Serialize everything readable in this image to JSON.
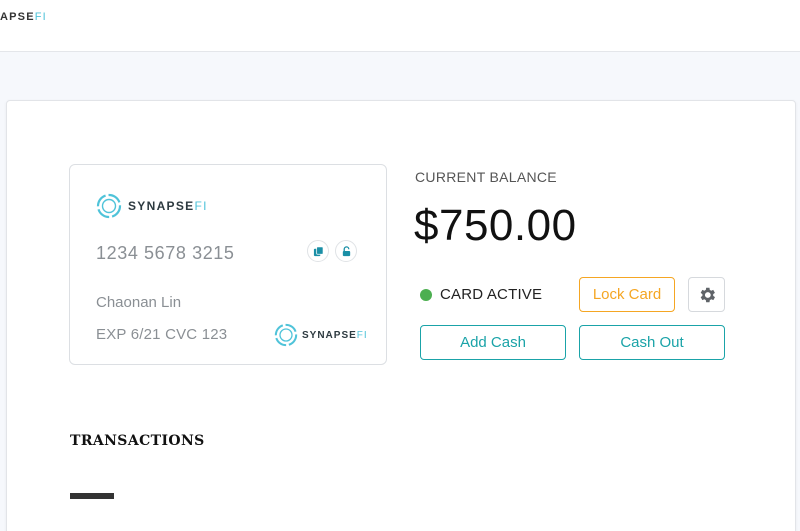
{
  "header": {
    "logo_main": "APSE",
    "logo_fi": "FI"
  },
  "card": {
    "brand_main": "SYNAPSE",
    "brand_fi": "FI",
    "number": "1234 5678 3215",
    "holder": "Chaonan Lin",
    "exp_cvc": "EXP 6/21 CVC 123",
    "icons": [
      "copy-icon",
      "lock-open-icon"
    ]
  },
  "balance": {
    "label": "CURRENT BALANCE",
    "value": "$750.00"
  },
  "status": {
    "label": "CARD ACTIVE",
    "color": "#4caf50"
  },
  "actions": {
    "lock_label": "Lock Card",
    "add_cash_label": "Add Cash",
    "cash_out_label": "Cash Out",
    "settings_icon": "gear-icon"
  },
  "transactions": {
    "title": "TRANSACTIONS"
  },
  "colors": {
    "accent": "#1aa3a8",
    "warning": "#f5a623",
    "brand_light": "#4fc3d9"
  }
}
